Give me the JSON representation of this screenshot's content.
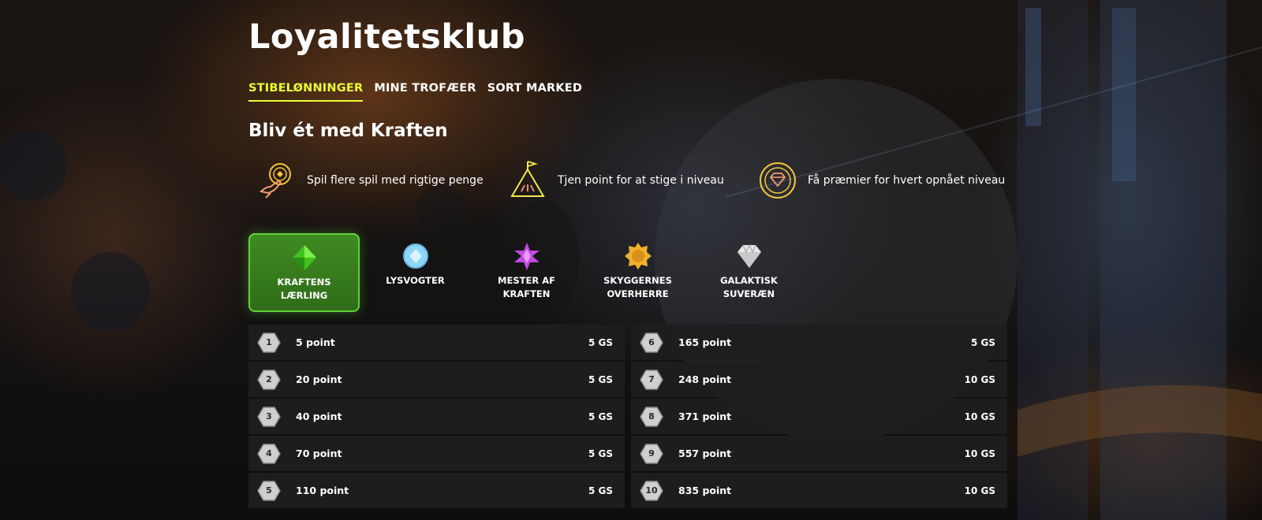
{
  "page": {
    "title": "Loyalitetsklub"
  },
  "tabs": [
    {
      "label": "STIBELØNNINGER",
      "active": true
    },
    {
      "label": "MINE TROFÆER",
      "active": false
    },
    {
      "label": "SORT MARKED",
      "active": false
    }
  ],
  "section": {
    "subtitle": "Bliv ét med Kraften"
  },
  "features": [
    {
      "icon": "coin-hand-icon",
      "text": "Spil flere spil med rigtige penge"
    },
    {
      "icon": "mountain-flag-icon",
      "text": "Tjen point for at stige i niveau"
    },
    {
      "icon": "diamond-coin-icon",
      "text": "Få præmier for hvert opnået niveau"
    }
  ],
  "tiers": [
    {
      "name_line1": "KRAFTENS",
      "name_line2": "LÆRLING",
      "icon": "green-gem-icon",
      "active": true
    },
    {
      "name_line1": "LYSVOGTER",
      "name_line2": "",
      "icon": "blue-gem-icon",
      "active": false
    },
    {
      "name_line1": "MESTER AF",
      "name_line2": "KRAFTEN",
      "icon": "purple-star-gem-icon",
      "active": false
    },
    {
      "name_line1": "SKYGGERNES",
      "name_line2": "OVERHERRE",
      "icon": "gold-sun-gem-icon",
      "active": false
    },
    {
      "name_line1": "GALAKTISK",
      "name_line2": "SUVERÆN",
      "icon": "white-diamond-icon",
      "active": false
    }
  ],
  "levels": {
    "left": [
      {
        "level": "1",
        "points": "5 point",
        "reward": "5 GS"
      },
      {
        "level": "2",
        "points": "20 point",
        "reward": "5 GS"
      },
      {
        "level": "3",
        "points": "40 point",
        "reward": "5 GS"
      },
      {
        "level": "4",
        "points": "70 point",
        "reward": "5 GS"
      },
      {
        "level": "5",
        "points": "110 point",
        "reward": "5 GS"
      }
    ],
    "right": [
      {
        "level": "6",
        "points": "165 point",
        "reward": "5 GS"
      },
      {
        "level": "7",
        "points": "248 point",
        "reward": "10 GS"
      },
      {
        "level": "8",
        "points": "371 point",
        "reward": "10 GS"
      },
      {
        "level": "9",
        "points": "557 point",
        "reward": "10 GS"
      },
      {
        "level": "10",
        "points": "835 point",
        "reward": "10 GS"
      }
    ]
  },
  "colors": {
    "accent": "#eaff34",
    "tier_active": "#3f8a22",
    "row_bg": "#1e1e20"
  }
}
